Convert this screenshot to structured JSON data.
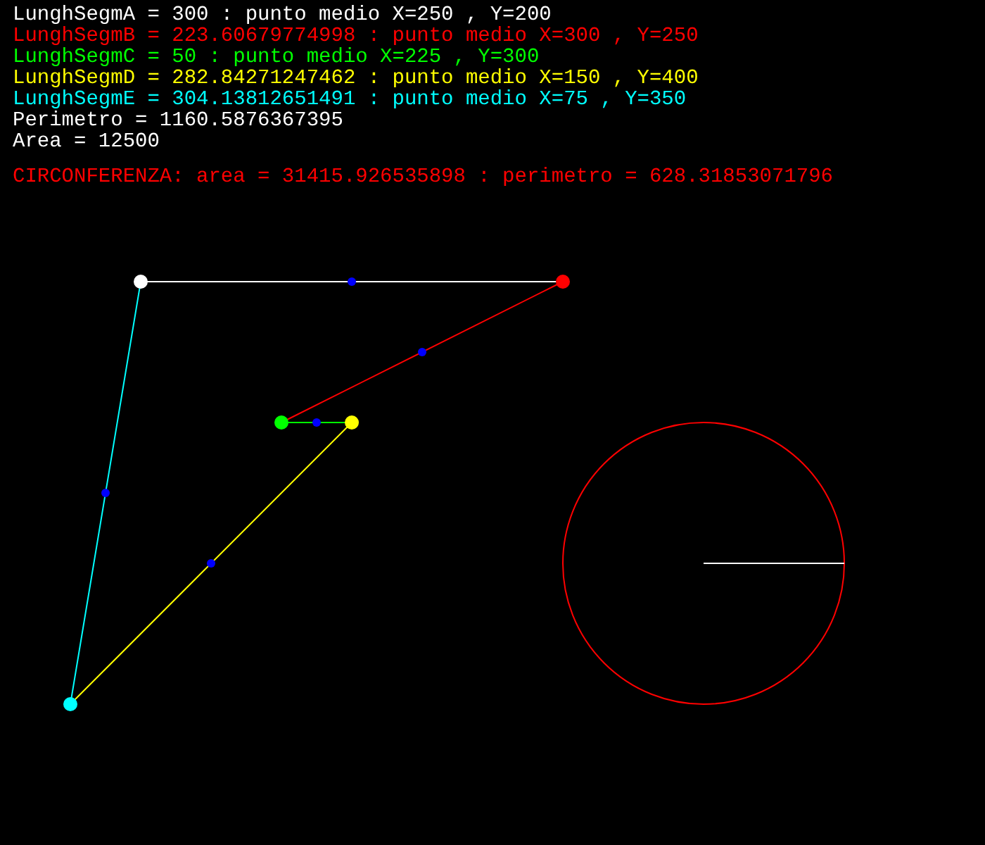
{
  "segments": [
    {
      "text": "LunghSegmA = 300 : punto medio X=250 , Y=200",
      "color": "#ffffff"
    },
    {
      "text": "LunghSegmB = 223.60679774998 : punto medio X=300 , Y=250",
      "color": "#ff0000"
    },
    {
      "text": "LunghSegmC = 50 : punto medio X=225 , Y=300",
      "color": "#00ff00"
    },
    {
      "text": "LunghSegmD = 282.84271247462 : punto medio X=150 , Y=400",
      "color": "#ffff00"
    },
    {
      "text": "LunghSegmE = 304.13812651491 : punto medio X=75 , Y=350",
      "color": "#00ffff"
    }
  ],
  "perimeter": "Perimetro = 1160.5876367395",
  "area": "Area = 12500",
  "circle": {
    "text": "CIRCONFERENZA: area = 31415.926535898 : perimetro = 628.31853071796",
    "color": "#ff0000"
  }
}
